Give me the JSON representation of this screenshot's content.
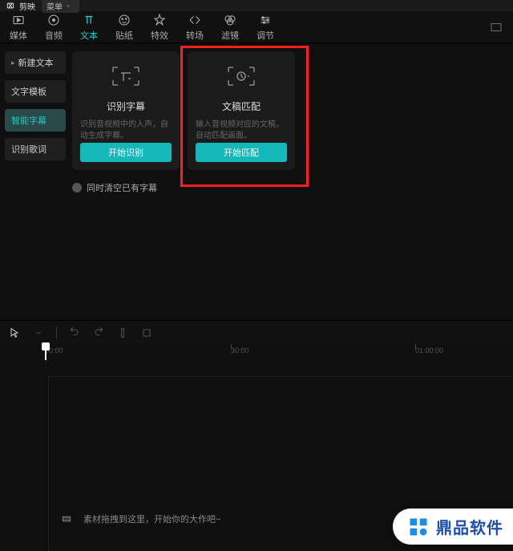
{
  "titlebar": {
    "app_name": "剪映",
    "menu_label": "菜单"
  },
  "tabs": [
    {
      "label": "媒体"
    },
    {
      "label": "音频"
    },
    {
      "label": "文本"
    },
    {
      "label": "贴纸"
    },
    {
      "label": "特效"
    },
    {
      "label": "转场"
    },
    {
      "label": "滤镜"
    },
    {
      "label": "调节"
    }
  ],
  "sidebar": {
    "items": [
      {
        "label": "新建文本"
      },
      {
        "label": "文字模板"
      },
      {
        "label": "智能字幕"
      },
      {
        "label": "识别歌词"
      }
    ]
  },
  "cards": {
    "recognize": {
      "title": "识别字幕",
      "desc": "识别音视频中的人声，自动生成字幕。",
      "button": "开始识别"
    },
    "match": {
      "title": "文稿匹配",
      "desc": "输入音视频对应的文稿，自动匹配画面。",
      "button": "开始匹配"
    }
  },
  "checkbox": {
    "label": "同时清空已有字幕"
  },
  "ruler": {
    "ticks": [
      {
        "pos": 56,
        "label": "00:00"
      },
      {
        "pos": 288,
        "label": "30:00"
      },
      {
        "pos": 518,
        "label": "01:00:00"
      }
    ]
  },
  "drop_hint": "素材拖拽到这里，开始你的大作吧~",
  "watermark": {
    "text": "鼎品软件"
  }
}
